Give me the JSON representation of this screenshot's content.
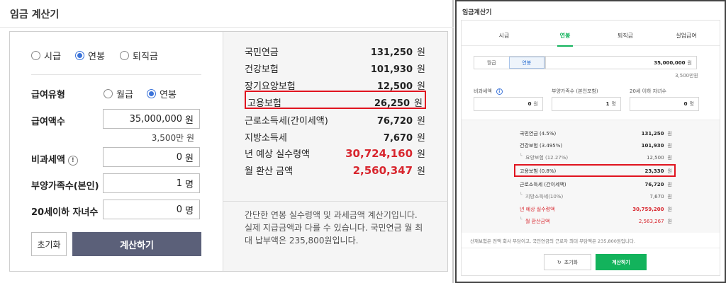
{
  "left": {
    "title": "임금 계산기",
    "type_options": [
      {
        "label": "시급",
        "selected": false
      },
      {
        "label": "연봉",
        "selected": true
      },
      {
        "label": "퇴직금",
        "selected": false
      }
    ],
    "pay_type": {
      "label": "급여유형",
      "options": [
        {
          "label": "월급",
          "selected": false
        },
        {
          "label": "연봉",
          "selected": true
        }
      ]
    },
    "salary": {
      "label": "급여액수",
      "value": "35,000,000",
      "unit": "원",
      "sub": "3,500만 원"
    },
    "nontax": {
      "label": "비과세액",
      "info": "!",
      "value": "0",
      "unit": "원"
    },
    "dependents": {
      "label": "부양가족수(본인)",
      "value": "1",
      "unit": "명"
    },
    "children": {
      "label": "20세이하 자녀수",
      "value": "0",
      "unit": "명"
    },
    "buttons": {
      "reset": "초기화",
      "calc": "계산하기"
    },
    "results": [
      {
        "name": "국민연금",
        "value": "131,250",
        "unit": "원"
      },
      {
        "name": "건강보험",
        "value": "101,930",
        "unit": "원"
      },
      {
        "name": "장기요양보험",
        "value": "12,500",
        "unit": "원"
      },
      {
        "name": "고용보험",
        "value": "26,250",
        "unit": "원"
      },
      {
        "name": "근로소득세(간이세액)",
        "value": "76,720",
        "unit": "원"
      },
      {
        "name": "지방소득세",
        "value": "7,670",
        "unit": "원"
      },
      {
        "name": "년 예상 실수령액",
        "value": "30,724,160",
        "unit": "원"
      },
      {
        "name": "월 환산 금액",
        "value": "2,560,347",
        "unit": "원"
      }
    ],
    "note": "간단한 연봉 실수령액 및 과세금액 계산기입니다. 실제 지급금액과 다를 수 있습니다. 국민연금 월 최대 납부액은 235,800원입니다."
  },
  "right": {
    "title": "임금계산기",
    "tabs": [
      {
        "label": "시급",
        "active": false
      },
      {
        "label": "연봉",
        "active": true
      },
      {
        "label": "퇴직금",
        "active": false
      },
      {
        "label": "실업급여",
        "active": false
      }
    ],
    "segment": [
      {
        "label": "월급",
        "selected": false
      },
      {
        "label": "연봉",
        "selected": true
      }
    ],
    "salary": {
      "value": "35,000,000",
      "unit": "원",
      "sub": "3,500만원"
    },
    "nontax": {
      "label": "비과세액",
      "info": "i",
      "value": "0",
      "unit": "원"
    },
    "dependents": {
      "label": "부양가족수 (본인포함)",
      "value": "1",
      "unit": "명"
    },
    "children": {
      "label": "20세 이하 자녀수",
      "value": "0",
      "unit": "명"
    },
    "results": [
      {
        "name": "국민연금 (4.5%)",
        "value": "131,250",
        "unit": "원"
      },
      {
        "name": "건강보험 (3.495%)",
        "value": "101,930",
        "unit": "원"
      },
      {
        "name": "요양보험 (12.27%)",
        "value": "12,500",
        "unit": "원"
      },
      {
        "name": "고용보험 (0.8%)",
        "value": "23,330",
        "unit": "원"
      },
      {
        "name": "근로소득세 (간이세액)",
        "value": "76,720",
        "unit": "원"
      },
      {
        "name": "지방소득세(10%)",
        "value": "7,670",
        "unit": "원"
      },
      {
        "name": "년 예상 실수령액",
        "value": "30,759,200",
        "unit": "원"
      },
      {
        "name": "월 환산금액",
        "value": "2,563,267",
        "unit": "원"
      }
    ],
    "note": "산재보험은 전액 회사 부담이고, 국민연금의 근로자 최대 부담액은 235,800원입니다.",
    "buttons": {
      "reset": "초기화",
      "calc": "계산하기"
    }
  },
  "colors": {
    "highlight": "#e0141f",
    "accent_red": "#d8262e",
    "calc_button": "#5b6079",
    "green": "#13b35c",
    "blue": "#3b73d9"
  }
}
